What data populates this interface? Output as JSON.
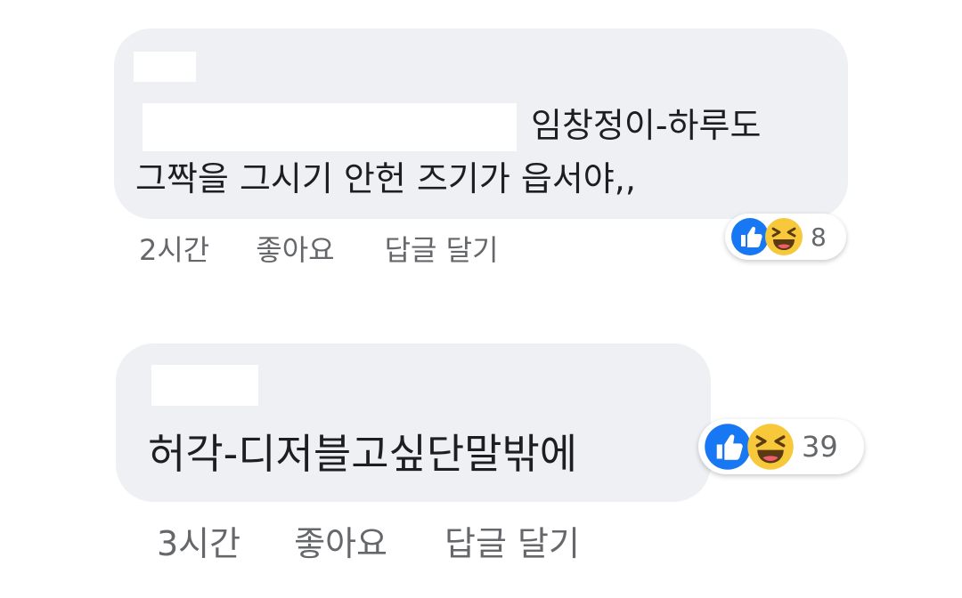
{
  "comments": [
    {
      "author": "",
      "text_line1": "임창정이-하루도",
      "text_line2": "그짝을 그시기 안헌 즈기가 읍서야,,",
      "time": "2시간",
      "like_label": "좋아요",
      "reply_label": "답글 달기",
      "reaction_count": "8",
      "reaction_icons": [
        "like-icon",
        "haha-icon"
      ]
    },
    {
      "author": "",
      "text": "허각-디저블고싶단말밖에",
      "time": "3시간",
      "like_label": "좋아요",
      "reply_label": "답글 달기",
      "reaction_count": "39",
      "reaction_icons": [
        "like-icon",
        "haha-icon"
      ]
    }
  ],
  "colors": {
    "bubble": "#eef0f3",
    "like_blue": "#1877f2",
    "haha_yellow": "#f7c83a",
    "meta_gray": "#65676b"
  }
}
